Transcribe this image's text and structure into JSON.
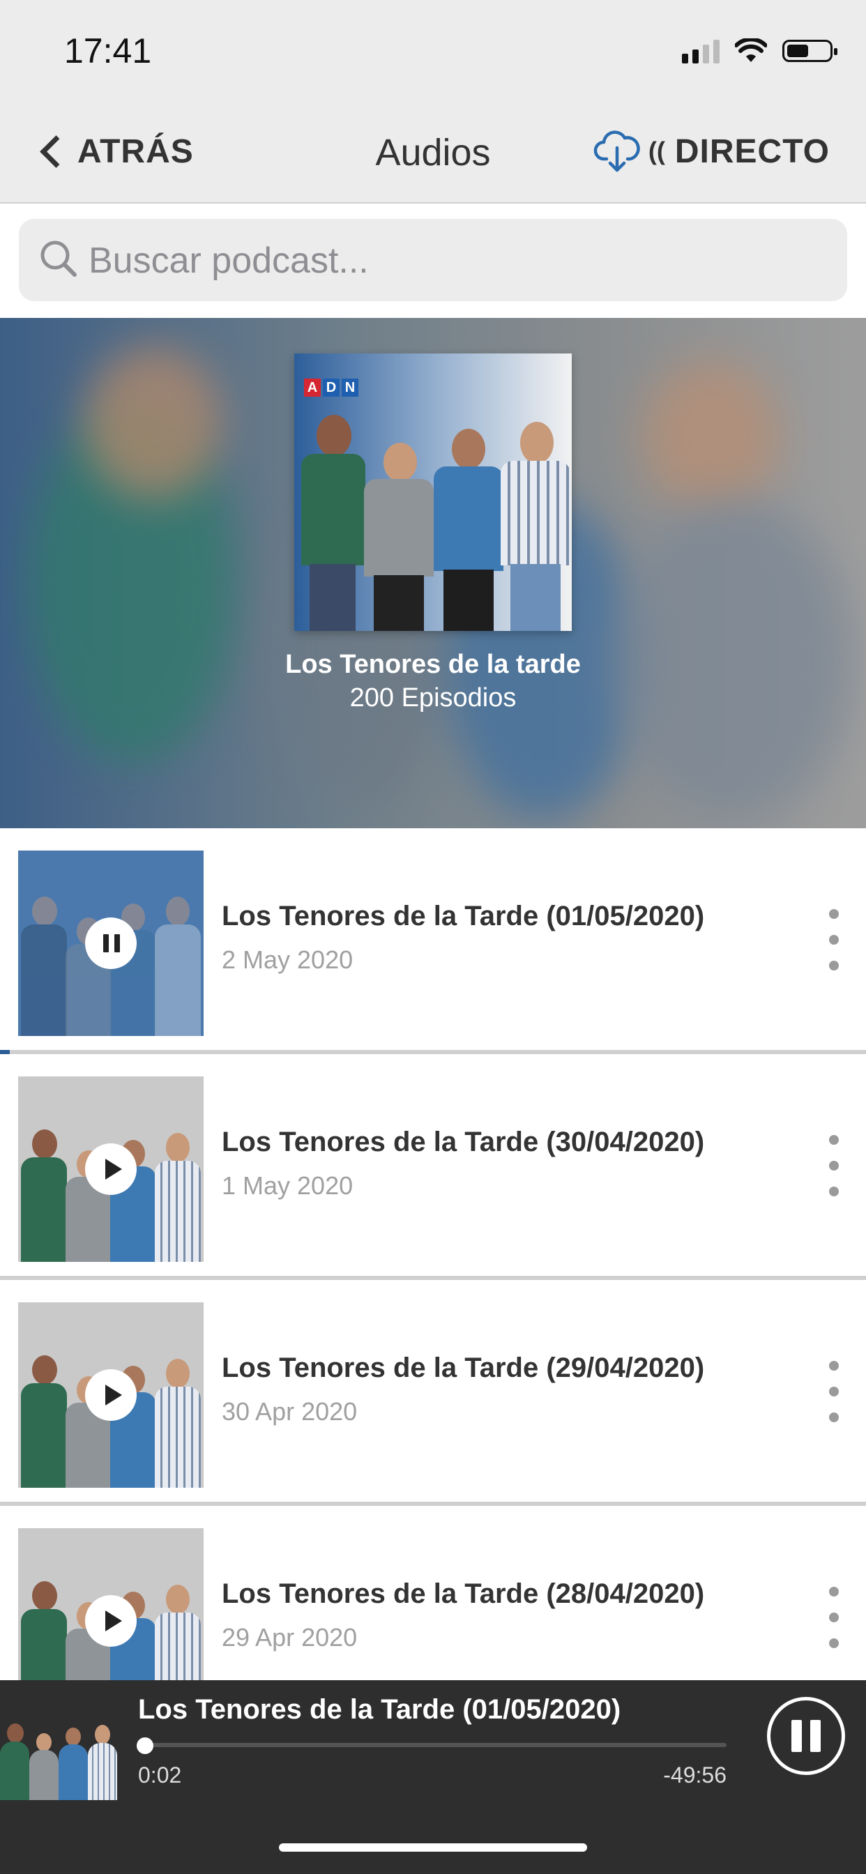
{
  "status_bar": {
    "time": "17:41"
  },
  "nav": {
    "back_label": "ATRÁS",
    "title": "Audios",
    "live_label": "DIRECTO"
  },
  "search": {
    "placeholder": "Buscar podcast..."
  },
  "podcast": {
    "title": "Los Tenores de la tarde",
    "episode_count": "200 Episodios",
    "logo_text": [
      "A",
      "D",
      "N"
    ]
  },
  "episodes": [
    {
      "title": "Los Tenores de la Tarde (01/05/2020)",
      "date": "2 May 2020",
      "state": "playing"
    },
    {
      "title": "Los Tenores de la Tarde (30/04/2020)",
      "date": "1 May 2020",
      "state": "paused"
    },
    {
      "title": "Los Tenores de la Tarde (29/04/2020)",
      "date": "30 Apr 2020",
      "state": "paused"
    },
    {
      "title": "Los Tenores de la Tarde (28/04/2020)",
      "date": "29 Apr 2020",
      "state": "paused"
    }
  ],
  "player": {
    "title": "Los Tenores de la Tarde (01/05/2020)",
    "elapsed": "0:02",
    "remaining": "-49:56",
    "progress": 0.001
  },
  "colors": {
    "accent_blue": "#2a6cb0",
    "bar_gray": "#ececec",
    "player_bg": "#2e2e2e",
    "adn_red": "#d62631",
    "adn_blue": "#1f5fb0"
  }
}
